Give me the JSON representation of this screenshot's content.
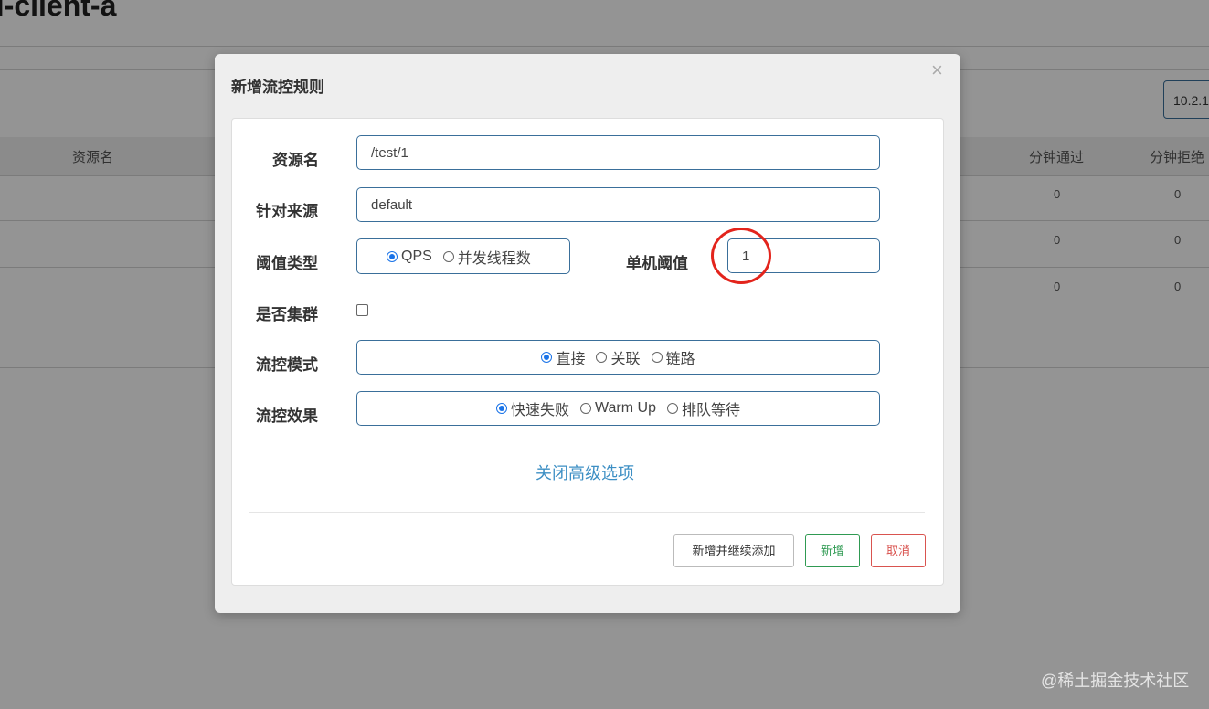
{
  "background": {
    "app_title": "el-client-a",
    "ip_select_value": "10.2.1",
    "table": {
      "col_resource": "资源名",
      "col_minute_pass": "分钟通过",
      "col_minute_reject": "分钟拒绝",
      "rows": [
        {
          "minute_pass": "0",
          "minute_reject": "0"
        },
        {
          "minute_pass": "0",
          "minute_reject": "0"
        },
        {
          "minute_pass": "0",
          "minute_reject": "0"
        }
      ]
    }
  },
  "modal": {
    "title": "新增流控规则",
    "close_symbol": "×",
    "form": {
      "resource_label": "资源名",
      "resource_value": "/test/1",
      "source_label": "针对来源",
      "source_value": "default",
      "threshold_type_label": "阈值类型",
      "threshold_type_options": [
        "QPS",
        "并发线程数"
      ],
      "threshold_type_selected": "QPS",
      "single_threshold_label": "单机阈值",
      "single_threshold_value": "1",
      "cluster_label": "是否集群",
      "cluster_checked": false,
      "mode_label": "流控模式",
      "mode_options": [
        "直接",
        "关联",
        "链路"
      ],
      "mode_selected": "直接",
      "effect_label": "流控效果",
      "effect_options": [
        "快速失败",
        "Warm Up",
        "排队等待"
      ],
      "effect_selected": "快速失败",
      "advanced_toggle": "关闭高级选项"
    },
    "buttons": {
      "add_and_continue": "新增并继续添加",
      "add": "新增",
      "cancel": "取消"
    }
  },
  "annotation_color": "#e3241c",
  "watermark": "@稀土掘金技术社区"
}
